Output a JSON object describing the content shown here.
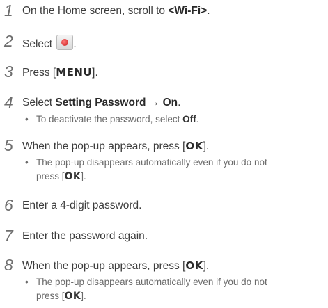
{
  "steps": [
    {
      "num": "1",
      "parts": {
        "a": "On the Home screen, scroll to ",
        "b": "<Wi-Fi>",
        "c": "."
      }
    },
    {
      "num": "2",
      "parts": {
        "a": "Select ",
        "c": "."
      },
      "icon": "wifi-lock-icon"
    },
    {
      "num": "3",
      "parts": {
        "a": "Press [",
        "key": "MENU",
        "c": "]."
      }
    },
    {
      "num": "4",
      "parts": {
        "a": "Select ",
        "b": "Setting Password",
        "arrow": " → ",
        "b2": "On",
        "c": "."
      },
      "sub": {
        "text": "To deactivate the password, select ",
        "bold": "Off",
        "end": "."
      }
    },
    {
      "num": "5",
      "parts": {
        "a": "When the pop-up appears, press [",
        "key": "OK",
        "c": "]."
      },
      "sub": {
        "line1": "The pop-up disappears automatically even if you do not",
        "line2a": "press [",
        "key": "OK",
        "line2c": "]."
      }
    },
    {
      "num": "6",
      "parts": {
        "a": "Enter a 4-digit password."
      }
    },
    {
      "num": "7",
      "parts": {
        "a": "Enter the password again."
      }
    },
    {
      "num": "8",
      "parts": {
        "a": "When the pop-up appears, press [",
        "key": "OK",
        "c": "]."
      },
      "sub": {
        "line1": "The pop-up disappears automatically even if you do not",
        "line2a": "press [",
        "key": "OK",
        "line2c": "]."
      }
    }
  ],
  "bullet": "•"
}
